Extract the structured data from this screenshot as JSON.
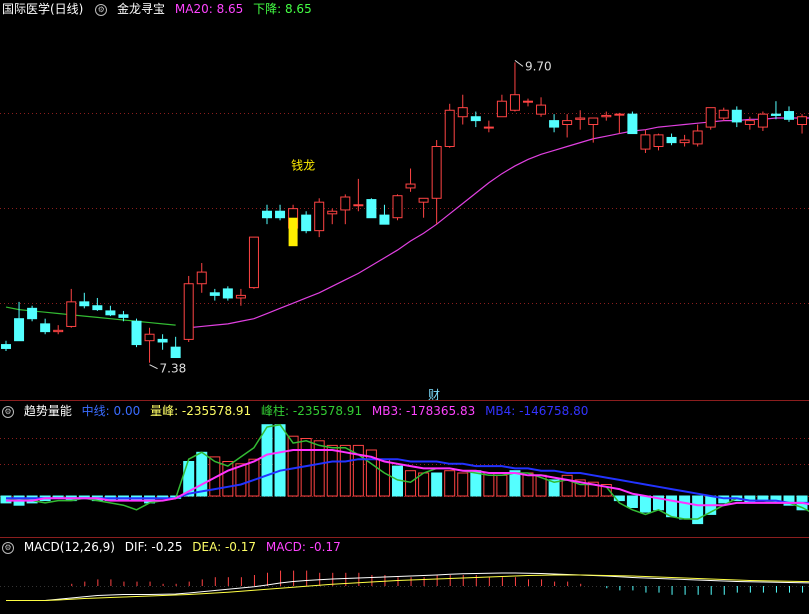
{
  "main_header": {
    "stock_name": "国际医学(日线)",
    "indicator_name": "金龙寻宝",
    "ma20_text": "MA20: 8.65",
    "down_text": "下降: 8.65"
  },
  "annotations": {
    "high_label": "9.70",
    "low_label": "7.38",
    "signal_label": "钱龙",
    "finance_label": "财"
  },
  "vol_header": {
    "name": "趋势量能",
    "items": [
      {
        "text": "中线: 0.00",
        "color": "#3a6cff"
      },
      {
        "text": "量峰: -235578.91",
        "color": "#ffff66"
      },
      {
        "text": "峰柱: -235578.91",
        "color": "#33cc33"
      },
      {
        "text": "MB3: -178365.83",
        "color": "#ff44ff"
      },
      {
        "text": "MB4: -146758.80",
        "color": "#3333ff"
      }
    ]
  },
  "macd_header": {
    "name": "MACD(12,26,9)",
    "dif": "DIF: -0.25",
    "dea": "DEA: -0.17",
    "macd": "MACD: -0.17"
  },
  "colors": {
    "up": "#ff4444",
    "down": "#54ffff",
    "ma20": "#e040e0",
    "ma_green": "#33bb33",
    "signal": "#ffee00",
    "grid": "#8b1e1e"
  },
  "candles": [
    [
      7.52,
      7.55,
      7.47,
      7.49
    ],
    [
      7.72,
      7.85,
      7.7,
      7.55
    ],
    [
      7.8,
      7.82,
      7.7,
      7.72
    ],
    [
      7.68,
      7.72,
      7.6,
      7.62
    ],
    [
      7.62,
      7.67,
      7.6,
      7.63
    ],
    [
      7.66,
      7.95,
      7.65,
      7.85
    ],
    [
      7.85,
      7.92,
      7.8,
      7.82
    ],
    [
      7.82,
      7.88,
      7.78,
      7.79
    ],
    [
      7.78,
      7.82,
      7.74,
      7.75
    ],
    [
      7.75,
      7.78,
      7.7,
      7.73
    ],
    [
      7.7,
      7.72,
      7.5,
      7.52
    ],
    [
      7.55,
      7.65,
      7.38,
      7.6
    ],
    [
      7.56,
      7.6,
      7.48,
      7.54
    ],
    [
      7.5,
      7.58,
      7.42,
      7.42
    ],
    [
      7.56,
      8.05,
      7.54,
      7.99
    ],
    [
      7.99,
      8.15,
      7.92,
      8.08
    ],
    [
      7.92,
      7.95,
      7.86,
      7.9
    ],
    [
      7.95,
      7.97,
      7.86,
      7.88
    ],
    [
      7.88,
      7.95,
      7.82,
      7.9
    ],
    [
      7.96,
      8.35,
      7.95,
      8.35
    ],
    [
      8.55,
      8.6,
      8.45,
      8.5
    ],
    [
      8.55,
      8.6,
      8.48,
      8.5
    ],
    [
      8.42,
      8.6,
      8.4,
      8.57
    ],
    [
      8.52,
      8.55,
      8.38,
      8.4
    ],
    [
      8.4,
      8.65,
      8.35,
      8.62
    ],
    [
      8.53,
      8.57,
      8.45,
      8.55
    ],
    [
      8.56,
      8.68,
      8.45,
      8.66
    ],
    [
      8.6,
      8.8,
      8.55,
      8.6
    ],
    [
      8.64,
      8.65,
      8.5,
      8.5
    ],
    [
      8.52,
      8.6,
      8.45,
      8.45
    ],
    [
      8.5,
      8.68,
      8.48,
      8.67
    ],
    [
      8.73,
      8.88,
      8.7,
      8.76
    ],
    [
      8.62,
      8.65,
      8.5,
      8.65
    ],
    [
      8.65,
      9.1,
      8.45,
      9.05
    ],
    [
      9.05,
      9.38,
      9.04,
      9.33
    ],
    [
      9.28,
      9.45,
      9.22,
      9.35
    ],
    [
      9.28,
      9.32,
      9.2,
      9.25
    ],
    [
      9.2,
      9.25,
      9.16,
      9.2
    ],
    [
      9.28,
      9.45,
      9.3,
      9.4
    ],
    [
      9.33,
      9.7,
      9.32,
      9.45
    ],
    [
      9.4,
      9.42,
      9.36,
      9.4
    ],
    [
      9.3,
      9.43,
      9.28,
      9.37
    ],
    [
      9.25,
      9.3,
      9.16,
      9.2
    ],
    [
      9.22,
      9.3,
      9.12,
      9.25
    ],
    [
      9.26,
      9.33,
      9.18,
      9.27
    ],
    [
      9.22,
      9.27,
      9.08,
      9.27
    ],
    [
      9.28,
      9.32,
      9.25,
      9.29
    ],
    [
      9.3,
      9.31,
      9.15,
      9.3
    ],
    [
      9.3,
      9.32,
      9.15,
      9.15
    ],
    [
      9.03,
      9.18,
      9.0,
      9.14
    ],
    [
      9.05,
      9.15,
      9.02,
      9.14
    ],
    [
      9.12,
      9.15,
      9.06,
      9.08
    ],
    [
      9.08,
      9.14,
      9.05,
      9.1
    ],
    [
      9.07,
      9.22,
      9.05,
      9.17
    ],
    [
      9.2,
      9.34,
      9.18,
      9.35
    ],
    [
      9.27,
      9.35,
      9.25,
      9.33
    ],
    [
      9.33,
      9.36,
      9.2,
      9.24
    ],
    [
      9.22,
      9.28,
      9.18,
      9.25
    ],
    [
      9.2,
      9.32,
      9.17,
      9.3
    ],
    [
      9.3,
      9.4,
      9.26,
      9.29
    ],
    [
      9.32,
      9.36,
      9.24,
      9.26
    ],
    [
      9.22,
      9.3,
      9.15,
      9.28
    ],
    [
      9.2,
      9.24,
      9.19,
      9.22
    ]
  ],
  "ma20": [
    null,
    null,
    null,
    null,
    null,
    null,
    null,
    null,
    null,
    null,
    null,
    null,
    null,
    null,
    7.65,
    7.66,
    7.67,
    7.68,
    7.7,
    7.72,
    7.76,
    7.8,
    7.84,
    7.88,
    7.92,
    7.97,
    8.02,
    8.07,
    8.13,
    8.19,
    8.25,
    8.32,
    8.38,
    8.45,
    8.53,
    8.61,
    8.69,
    8.77,
    8.84,
    8.9,
    8.95,
    8.99,
    9.02,
    9.05,
    9.08,
    9.11,
    9.13,
    9.15,
    9.17,
    9.18,
    9.2,
    9.21,
    9.22,
    9.23,
    9.24,
    9.25,
    9.25,
    9.26,
    9.26,
    9.27,
    9.27,
    9.27,
    9.27
  ],
  "ma_green": [
    7.81,
    7.79,
    7.78,
    7.77,
    7.76,
    7.75,
    7.74,
    7.73,
    7.72,
    7.71,
    7.7,
    7.69,
    7.68,
    7.67
  ],
  "signal_bar": {
    "index": 22,
    "top": 8.5,
    "bottom": 8.28
  },
  "vol_bars": [
    -3,
    -4,
    -3,
    -2,
    -1,
    -2,
    -1,
    -2,
    -2,
    -2,
    -2,
    -3,
    -1,
    -1,
    15,
    19,
    17,
    15,
    14,
    16,
    31,
    31,
    26,
    25,
    24,
    22,
    22,
    22,
    20,
    16,
    13,
    11,
    10,
    10,
    11,
    10,
    11,
    10,
    9,
    11,
    10,
    9,
    7,
    9,
    7,
    6,
    5,
    -2,
    -5,
    -7,
    -6,
    -9,
    -10,
    -12,
    -8,
    -3,
    -2,
    -3,
    -2,
    -3,
    -4,
    -6,
    -10
  ],
  "vol_lines": {
    "green": [
      -2,
      -1,
      -2,
      -3,
      -2,
      -2,
      -1,
      -2,
      -3,
      -4,
      -6,
      -3,
      -2,
      -1,
      16,
      19,
      15,
      13,
      17,
      21,
      30,
      31,
      23,
      24,
      22,
      21,
      21,
      18,
      14,
      10,
      7,
      6,
      10,
      12,
      12,
      11,
      10,
      9,
      9,
      10,
      10,
      8,
      6,
      7,
      5,
      5,
      4,
      -3,
      -6,
      -8,
      -6,
      -9,
      -10,
      -10,
      -7,
      -4,
      -1,
      -2,
      -2,
      -3,
      -3,
      -5,
      -8
    ],
    "magenta": [
      -2,
      -2,
      -2,
      -1,
      -1,
      -1,
      -1,
      -1,
      -2,
      -2,
      -2,
      -2,
      -2,
      -1,
      2,
      5,
      8,
      11,
      13,
      15,
      18,
      19,
      20,
      20,
      20,
      20,
      19,
      18,
      17,
      15,
      14,
      13,
      12,
      12,
      12,
      11,
      11,
      10,
      10,
      10,
      9,
      9,
      8,
      7,
      6,
      5,
      4,
      3,
      1,
      0,
      -1,
      -2,
      -3,
      -4,
      -4,
      -4,
      -3,
      -3,
      -3,
      -3,
      -3,
      -3,
      -4
    ],
    "blue": [
      -1,
      -1,
      -1,
      -1,
      -1,
      -1,
      -1,
      -1,
      -1,
      -1,
      -1,
      -1,
      -1,
      -1,
      1,
      2,
      3,
      4,
      5,
      7,
      9,
      11,
      12,
      13,
      14,
      15,
      15,
      16,
      16,
      16,
      16,
      15,
      15,
      15,
      14,
      14,
      13,
      13,
      13,
      12,
      12,
      11,
      11,
      10,
      10,
      9,
      8,
      7,
      6,
      5,
      4,
      3,
      2,
      1,
      0,
      -1,
      -1,
      -2,
      -2,
      -2,
      -3,
      -3,
      -3
    ]
  },
  "macd_bars": [
    0,
    0,
    0,
    0,
    0,
    0.1,
    0.2,
    0.3,
    0.3,
    0.2,
    0.2,
    0.2,
    0.1,
    0.1,
    0.2,
    0.3,
    0.4,
    0.4,
    0.4,
    0.5,
    0.6,
    0.7,
    0.7,
    0.7,
    0.6,
    0.6,
    0.6,
    0.6,
    0.5,
    0.5,
    0.4,
    0.4,
    0.4,
    0.5,
    0.5,
    0.5,
    0.5,
    0.4,
    0.4,
    0.4,
    0.3,
    0.3,
    0.2,
    0.2,
    0.1,
    0,
    -0.1,
    -0.2,
    -0.2,
    -0.3,
    -0.3,
    -0.4,
    -0.4,
    -0.4,
    -0.4,
    -0.4,
    -0.3,
    -0.3,
    -0.3,
    -0.3,
    -0.3,
    -0.3,
    -0.3
  ],
  "macd_dif": [
    -0.1,
    -0.1,
    -0.1,
    -0.1,
    -0.05,
    0,
    0.05,
    0.1,
    0.12,
    0.14,
    0.14,
    0.14,
    0.15,
    0.16,
    0.2,
    0.25,
    0.3,
    0.35,
    0.4,
    0.45,
    0.52,
    0.6,
    0.66,
    0.7,
    0.73,
    0.76,
    0.78,
    0.8,
    0.82,
    0.84,
    0.86,
    0.88,
    0.9,
    0.92,
    0.95,
    0.97,
    0.98,
    0.99,
    1.0,
    1.0,
    0.99,
    0.98,
    0.96,
    0.94,
    0.92,
    0.9,
    0.88,
    0.85,
    0.82,
    0.8,
    0.78,
    0.76,
    0.74,
    0.72,
    0.7,
    0.68,
    0.66,
    0.65,
    0.64,
    0.63,
    0.62,
    0.61,
    0.6
  ],
  "macd_dea": [
    -0.1,
    -0.1,
    -0.1,
    -0.1,
    -0.08,
    -0.05,
    -0.02,
    0,
    0.02,
    0.04,
    0.06,
    0.08,
    0.1,
    0.12,
    0.14,
    0.17,
    0.2,
    0.23,
    0.27,
    0.31,
    0.35,
    0.39,
    0.43,
    0.47,
    0.51,
    0.55,
    0.58,
    0.61,
    0.64,
    0.67,
    0.7,
    0.72,
    0.74,
    0.76,
    0.78,
    0.8,
    0.82,
    0.84,
    0.86,
    0.88,
    0.9,
    0.91,
    0.92,
    0.92,
    0.92,
    0.91,
    0.9,
    0.89,
    0.88,
    0.86,
    0.84,
    0.82,
    0.8,
    0.78,
    0.76,
    0.74,
    0.72,
    0.7,
    0.69,
    0.68,
    0.67,
    0.66,
    0.65
  ]
}
